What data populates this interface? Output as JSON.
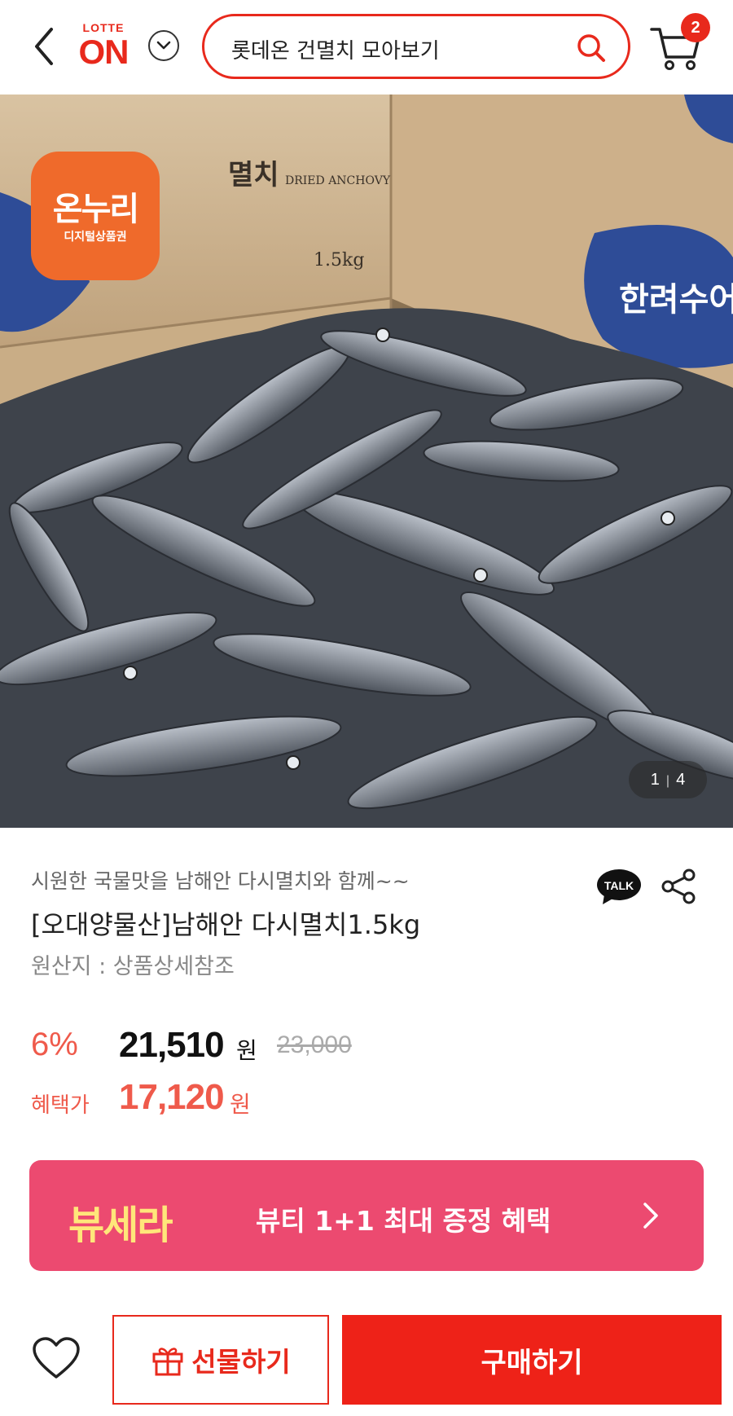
{
  "header": {
    "logo_top": "LOTTE",
    "logo_main": "ON",
    "search_text": "롯데온 건멸치 모아보기",
    "cart_count": "2"
  },
  "hero": {
    "box_label_1": "멸치",
    "box_label_2": "DRIED ANCHOVY",
    "box_weight": "1.5kg",
    "box_brand": "한려수어",
    "voucher_main": "온누리",
    "voucher_sub": "디지털상품권",
    "page_current": "1",
    "page_total": "4"
  },
  "product": {
    "subtitle": "시원한 국물맛을 남해안 다시멸치와 함께~~",
    "title": "[오대양물산]남해안 다시멸치1.5kg",
    "origin": "원산지 : 상품상세참조",
    "talk_label": "TALK"
  },
  "price": {
    "discount": "6%",
    "sale_price": "21,510",
    "unit": "원",
    "original_price": "23,000",
    "benefit_label": "혜택가",
    "benefit_price": "17,120"
  },
  "promo": {
    "brand": "뷰세라",
    "text": "뷰티 1+1 최대 증정 혜택"
  },
  "bottom_bar": {
    "gift_label": "선물하기",
    "buy_label": "구매하기"
  },
  "colors": {
    "brand_red": "#e8291c",
    "price_red": "#ef5a4b",
    "promo_pink": "#ec4a70",
    "voucher_orange": "#ef6a2b"
  }
}
